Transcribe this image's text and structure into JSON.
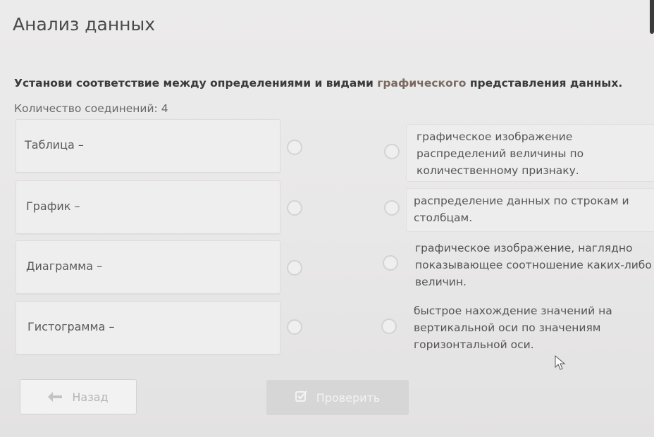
{
  "app": {
    "title": "Анализ данных"
  },
  "task": {
    "instruction_part1": "Установи соответствие между определениями и видами ",
    "instruction_highlight": "графического",
    "instruction_part2": " представления данных.",
    "connections_count": "Количество соединений: 4"
  },
  "terms": [
    {
      "label": "Таблица –"
    },
    {
      "label": "График –"
    },
    {
      "label": "Диаграмма –"
    },
    {
      "label": "Гистограмма –"
    }
  ],
  "definitions": [
    {
      "text": "графическое изображение распределений величины по количественному признаку."
    },
    {
      "text": "распределение данных по строкам и столбцам."
    },
    {
      "text": "графическое изображение, наглядно показывающее соотношение каких-либо величин."
    },
    {
      "text": "быстрое нахождение значений на вертикальной оси по значениям горизонтальной оси."
    }
  ],
  "buttons": {
    "back_label": "Назад",
    "check_label": "Проверить"
  },
  "icons": {
    "back": "arrow-left-icon",
    "check": "checkbox-check-icon",
    "cursor": "mouse-pointer-icon"
  },
  "colors": {
    "instruction_highlight": "#7a6a60",
    "disabled_button": "#d6d6d6"
  }
}
